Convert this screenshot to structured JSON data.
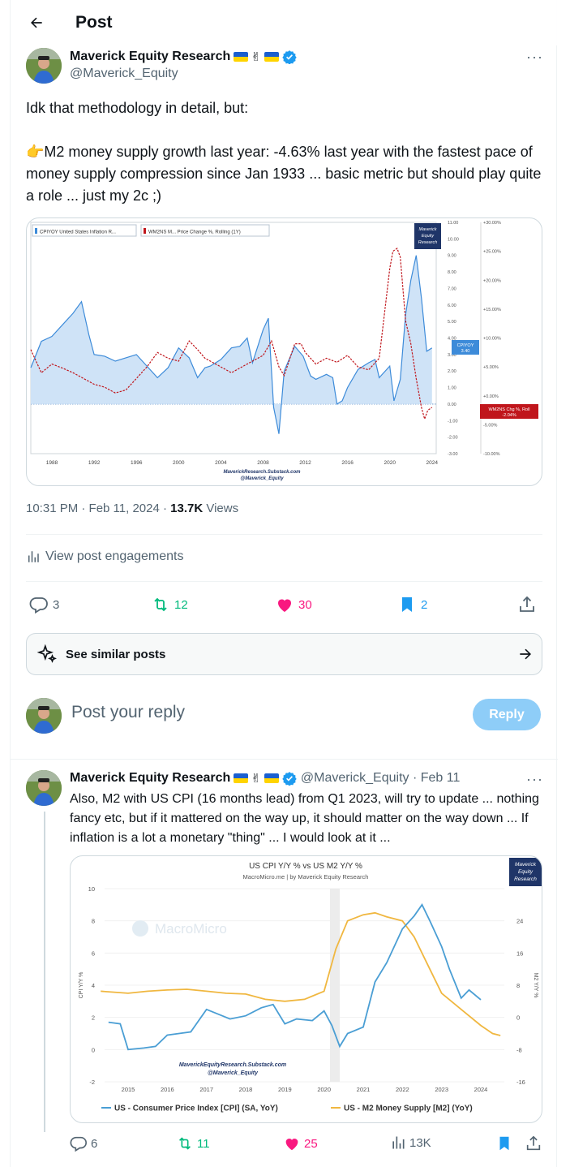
{
  "header": {
    "title": "Post"
  },
  "post": {
    "author_name": "Maverick Equity Research",
    "author_handle": "@Maverick_Equity",
    "text_line1": "Idk that methodology in detail, but:",
    "text_line2": "👉M2 money supply growth last year: -4.63% last year with the fastest pace of money supply compression since Jan 1933 ... basic metric but should play quite a role ... just my 2c ;)",
    "time": "10:31 PM · Feb 11, 2024 · ",
    "views_count": "13.7K",
    "views_label": " Views",
    "engagements_label": "View post engagements",
    "replies": "3",
    "reposts": "12",
    "likes": "30",
    "bookmarks": "2",
    "similar_label": "See similar posts"
  },
  "reply_box": {
    "placeholder": "Post your reply",
    "button": "Reply"
  },
  "reply": {
    "author_name": "Maverick Equity Research",
    "handle_date": "@Maverick_Equity · Feb 11",
    "text": "Also, M2 with US CPI (16 months lead) from Q1 2023, will try to update ... nothing fancy etc, but if it mattered on the way up, it should matter on the way down ... If inflation is a lot a monetary \"thing\" ... I would look at it ...",
    "replies": "6",
    "reposts": "11",
    "likes": "25",
    "views": "13K"
  },
  "colors": {
    "accent": "#1d9bf0",
    "like": "#f91880",
    "repost": "#00ba7c",
    "cpi_blue": "#3d8bd9",
    "m2_red": "#c0161c",
    "m2_yellow": "#f0b740"
  },
  "chart_data": [
    {
      "type": "line",
      "legend": [
        "CPIYOY United States Inflation R...",
        "WM2NS M... Price Change %, Rolling (1Y)"
      ],
      "badge": [
        "Maverick",
        "Equity",
        "Research"
      ],
      "x_ticks": [
        "1988",
        "1992",
        "1996",
        "2000",
        "2004",
        "2008",
        "2012",
        "2016",
        "2020",
        "2024"
      ],
      "left_ticks": [
        "11.00",
        "10.00",
        "9.00",
        "8.00",
        "7.00",
        "6.00",
        "5.00",
        "4.00",
        "3.00",
        "2.00",
        "1.00",
        "0.00",
        "-1.00",
        "-2.00",
        "-3.00"
      ],
      "right_ticks": [
        "+30.00%",
        "+25.00%",
        "+20.00%",
        "+15.00%",
        "+10.00%",
        "+5.00%",
        "+0.00%",
        "-5.00%",
        "-10.00%"
      ],
      "cpi_label": [
        "CPIYOY",
        "3.40"
      ],
      "m2_label": [
        "WM2NS Chg %, Roll",
        "-2.04%"
      ],
      "watermark": [
        "MaverickResearch.Substack.com",
        "@Maverick_Equity"
      ],
      "ylim_left": [
        -3,
        11
      ],
      "ylim_right": [
        -10,
        30
      ],
      "series": [
        {
          "name": "CPIYOY",
          "x": [
            1986.0,
            1987.0,
            1988.0,
            1989.0,
            1990.0,
            1990.8,
            1991.5,
            1992.0,
            1993.0,
            1994.0,
            1995.0,
            1996.0,
            1997.0,
            1998.0,
            1999.0,
            2000.0,
            2001.0,
            2001.8,
            2002.5,
            2003.0,
            2004.0,
            2005.0,
            2005.8,
            2006.5,
            2007.0,
            2008.0,
            2008.5,
            2009.0,
            2009.5,
            2010.0,
            2011.0,
            2011.8,
            2012.5,
            2013.0,
            2014.0,
            2014.6,
            2015.0,
            2015.5,
            2016.0,
            2017.0,
            2018.0,
            2018.6,
            2019.0,
            2020.0,
            2020.4,
            2021.0,
            2021.5,
            2022.0,
            2022.5,
            2023.0,
            2023.5,
            2024.0
          ],
          "values": [
            2.2,
            3.8,
            4.1,
            4.8,
            5.5,
            6.2,
            4.2,
            3.0,
            2.9,
            2.6,
            2.8,
            3.0,
            2.3,
            1.6,
            2.2,
            3.4,
            2.8,
            1.6,
            2.2,
            2.3,
            2.7,
            3.4,
            3.5,
            4.0,
            2.5,
            4.5,
            5.2,
            -0.2,
            -1.8,
            2.0,
            3.5,
            2.9,
            1.7,
            1.5,
            1.8,
            1.6,
            0.0,
            0.2,
            1.0,
            2.1,
            2.5,
            2.7,
            1.6,
            2.3,
            0.2,
            1.5,
            5.4,
            7.5,
            9.0,
            6.4,
            3.2,
            3.4
          ]
        },
        {
          "name": "WM2NS",
          "x": [
            1986.0,
            1987.0,
            1988.0,
            1989.0,
            1990.0,
            1991.0,
            1992.0,
            1993.0,
            1994.0,
            1995.0,
            1996.0,
            1997.0,
            1998.0,
            1999.0,
            2000.0,
            2001.0,
            2001.8,
            2002.5,
            2003.0,
            2004.0,
            2005.0,
            2006.0,
            2007.0,
            2008.0,
            2008.8,
            2009.5,
            2010.0,
            2011.0,
            2011.6,
            2012.0,
            2013.0,
            2014.0,
            2015.0,
            2016.0,
            2017.0,
            2018.0,
            2019.0,
            2020.0,
            2020.3,
            2020.7,
            2021.0,
            2021.5,
            2022.0,
            2022.5,
            2023.0,
            2023.3,
            2023.6,
            2024.0
          ],
          "values": [
            8.0,
            4.0,
            5.5,
            4.8,
            4.0,
            3.0,
            2.0,
            1.5,
            0.5,
            1.0,
            3.0,
            5.0,
            7.5,
            6.5,
            6.0,
            9.5,
            8.0,
            6.5,
            6.0,
            5.0,
            4.0,
            5.0,
            6.0,
            7.0,
            9.5,
            5.0,
            3.5,
            9.0,
            9.0,
            7.5,
            5.5,
            6.5,
            5.8,
            7.0,
            5.0,
            4.5,
            6.5,
            22.0,
            25.0,
            25.5,
            24.0,
            13.0,
            9.0,
            3.0,
            -2.0,
            -4.0,
            -2.5,
            -2.0
          ]
        }
      ]
    },
    {
      "type": "line",
      "title": "US CPI Y/Y % vs US M2 Y/Y %",
      "subtitle": "MacroMicro.me | by Maverick Equity Research",
      "badge": [
        "Maverick",
        "Equity",
        "Research"
      ],
      "watermark_brand": "MacroMicro",
      "watermark": [
        "MaverickEquityResearch.Substack.com",
        "@Maverick_Equity"
      ],
      "ylabel_left": "CPI Y/Y %",
      "ylabel_right": "M2 Y/Y %",
      "x_ticks": [
        "2015",
        "2016",
        "2017",
        "2018",
        "2019",
        "2020",
        "2021",
        "2022",
        "2023",
        "2024"
      ],
      "left_ticks": [
        "10",
        "8",
        "6",
        "4",
        "2",
        "0",
        "-2"
      ],
      "right_ticks": [
        "24",
        "16",
        "8",
        "0",
        "-8",
        "-16"
      ],
      "ylim_left": [
        -2,
        10
      ],
      "ylim_right": [
        -16,
        32
      ],
      "series": [
        {
          "name": "US - Consumer Price Index [CPI] (SA, YoY)",
          "x": [
            2014.5,
            2014.8,
            2015.0,
            2015.4,
            2015.7,
            2016.0,
            2016.3,
            2016.6,
            2017.0,
            2017.3,
            2017.6,
            2018.0,
            2018.4,
            2018.7,
            2019.0,
            2019.3,
            2019.7,
            2020.0,
            2020.2,
            2020.4,
            2020.6,
            2021.0,
            2021.3,
            2021.6,
            2022.0,
            2022.3,
            2022.5,
            2022.7,
            2023.0,
            2023.2,
            2023.5,
            2023.7,
            2024.0
          ],
          "values": [
            1.7,
            1.6,
            0.0,
            0.1,
            0.2,
            0.9,
            1.0,
            1.1,
            2.5,
            2.2,
            1.9,
            2.1,
            2.6,
            2.8,
            1.6,
            1.9,
            1.8,
            2.4,
            1.5,
            0.2,
            1.0,
            1.4,
            4.2,
            5.4,
            7.5,
            8.3,
            9.0,
            8.0,
            6.4,
            5.0,
            3.2,
            3.7,
            3.1
          ]
        },
        {
          "name": "US - M2 Money Supply [M2] (YoY)",
          "x": [
            2014.3,
            2015.0,
            2015.5,
            2016.0,
            2016.5,
            2017.0,
            2017.5,
            2018.0,
            2018.5,
            2019.0,
            2019.5,
            2020.0,
            2020.3,
            2020.6,
            2021.0,
            2021.3,
            2021.6,
            2022.0,
            2022.3,
            2022.6,
            2023.0,
            2023.5,
            2024.0,
            2024.3,
            2024.5
          ],
          "values": [
            6.5,
            6.0,
            6.5,
            6.8,
            7.0,
            6.5,
            6.0,
            5.8,
            4.5,
            4.0,
            4.5,
            6.5,
            17.0,
            24.0,
            25.5,
            26.0,
            25.0,
            24.0,
            20.0,
            14.0,
            6.0,
            2.0,
            -2.0,
            -4.0,
            -4.5
          ]
        }
      ],
      "legend": [
        "US - Consumer Price Index [CPI] (SA, YoY)",
        "US - M2 Money Supply [M2] (YoY)"
      ]
    }
  ]
}
